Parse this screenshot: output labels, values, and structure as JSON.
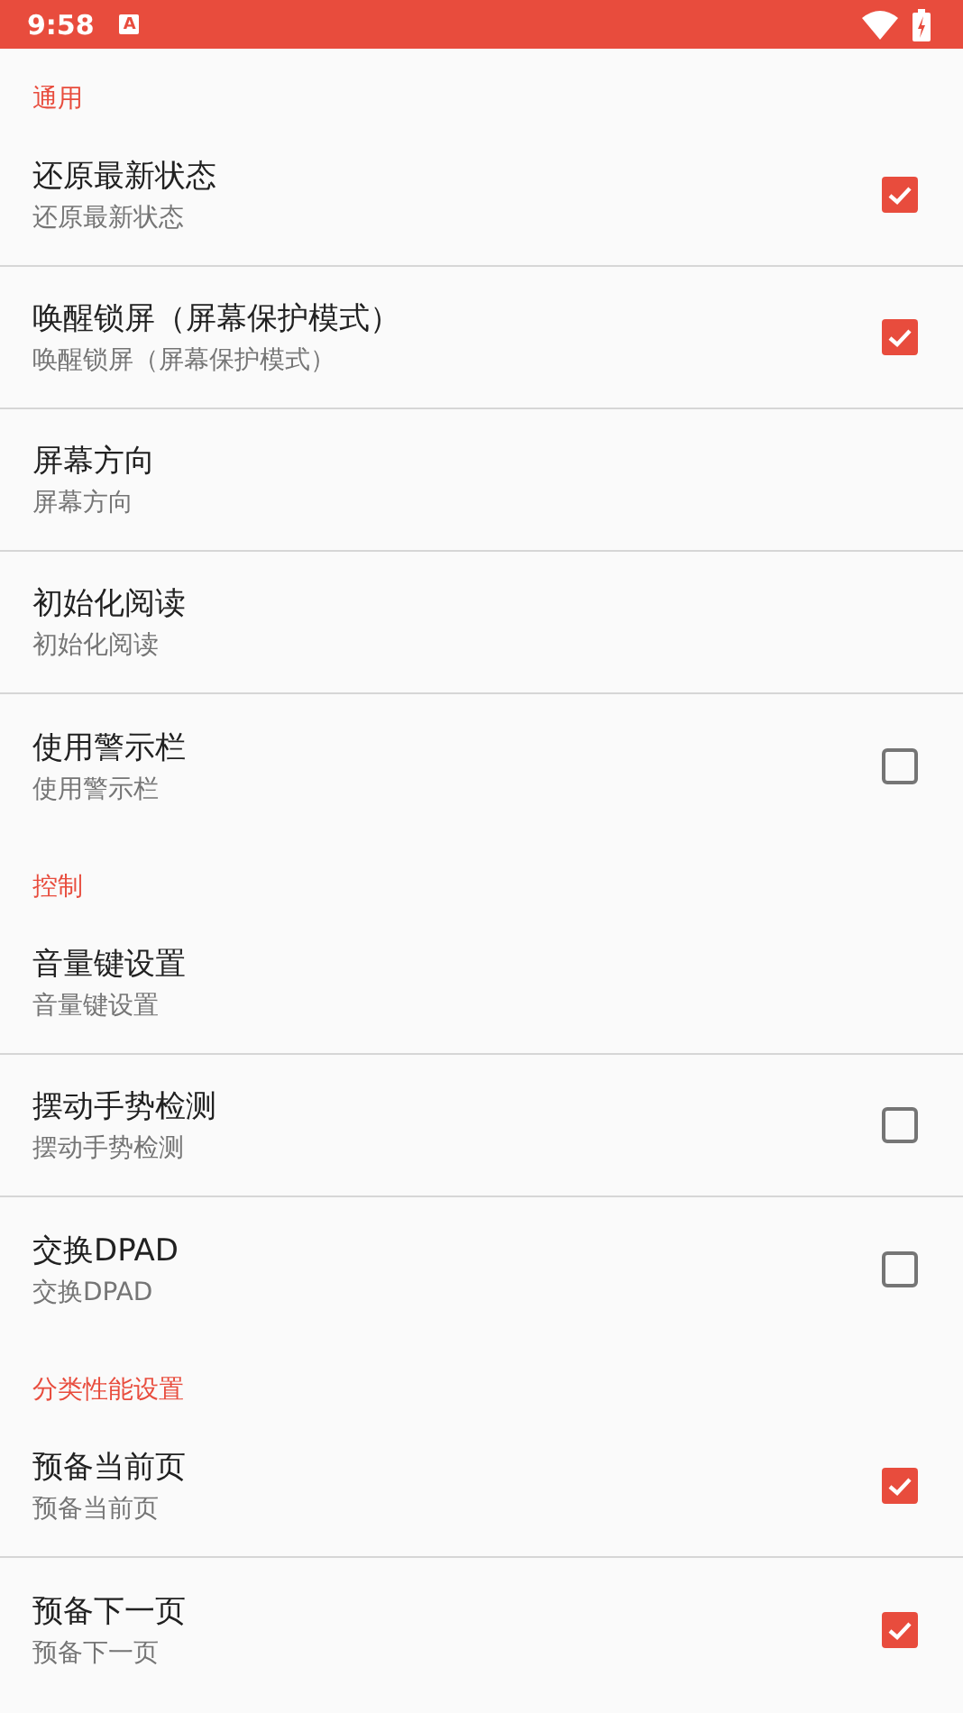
{
  "status_bar": {
    "time": "9:58",
    "notification": "A"
  },
  "sections": [
    {
      "title": "通用",
      "items": [
        {
          "title": "还原最新状态",
          "summary": "还原最新状态",
          "kind": "checkbox",
          "checked": true
        },
        {
          "title": "唤醒锁屏（屏幕保护模式）",
          "summary": "唤醒锁屏（屏幕保护模式）",
          "kind": "checkbox",
          "checked": true
        },
        {
          "title": "屏幕方向",
          "summary": "屏幕方向",
          "kind": "plain"
        },
        {
          "title": "初始化阅读",
          "summary": "初始化阅读",
          "kind": "plain"
        },
        {
          "title": "使用警示栏",
          "summary": "使用警示栏",
          "kind": "checkbox",
          "checked": false
        }
      ]
    },
    {
      "title": "控制",
      "items": [
        {
          "title": "音量键设置",
          "summary": "音量键设置",
          "kind": "plain"
        },
        {
          "title": "摆动手势检测",
          "summary": "摆动手势检测",
          "kind": "checkbox",
          "checked": false
        },
        {
          "title": "交换DPAD",
          "summary": "交换DPAD",
          "kind": "checkbox",
          "checked": false
        }
      ]
    },
    {
      "title": "分类性能设置",
      "items": [
        {
          "title": "预备当前页",
          "summary": "预备当前页",
          "kind": "checkbox",
          "checked": true
        },
        {
          "title": "预备下一页",
          "summary": "预备下一页",
          "kind": "checkbox",
          "checked": true
        }
      ]
    }
  ]
}
